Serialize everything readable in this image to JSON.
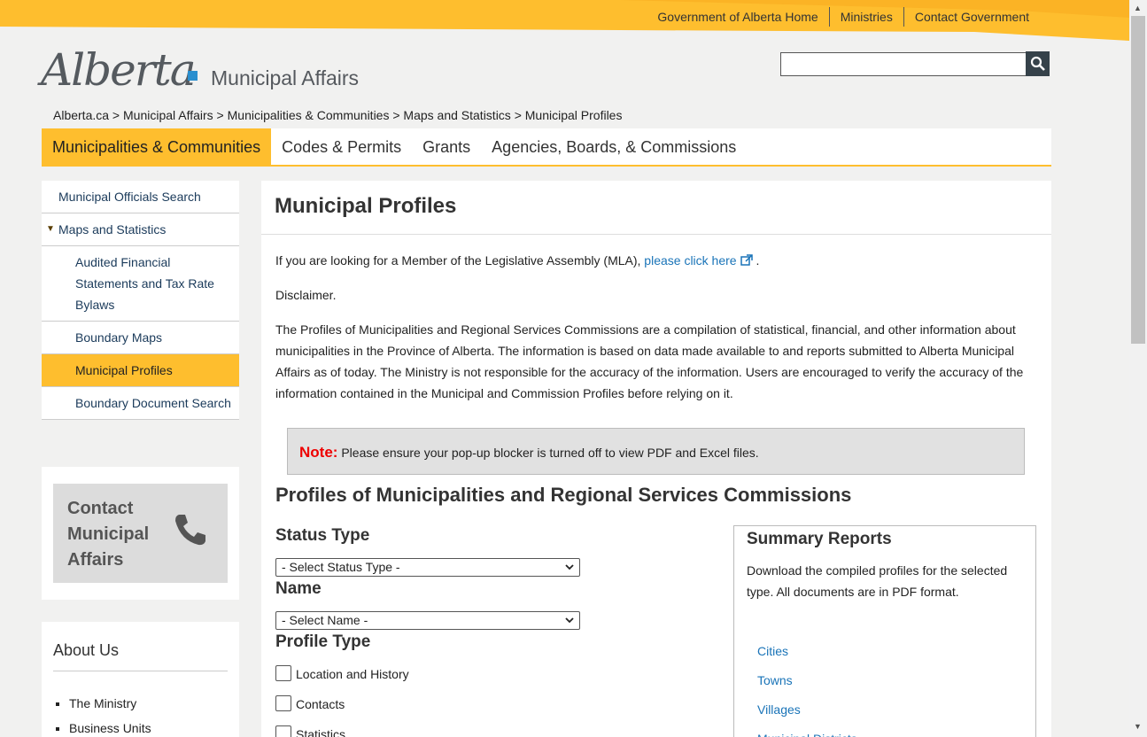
{
  "top_links": [
    "Government of Alberta Home",
    "Ministries",
    "Contact Government"
  ],
  "logo": {
    "script": "Alberta",
    "ministry": "Municipal Affairs"
  },
  "breadcrumb": "Alberta.ca > Municipal Affairs > Municipalities & Communities > Maps and Statistics > Municipal Profiles",
  "main_nav": [
    "Municipalities & Communities",
    "Codes & Permits",
    "Grants",
    "Agencies, Boards, & Commissions"
  ],
  "side_nav": {
    "officials": "Municipal Officials Search",
    "maps": "Maps and Statistics",
    "audited": "Audited Financial Statements and Tax Rate Bylaws",
    "boundary_maps": "Boundary Maps",
    "profiles": "Municipal Profiles",
    "boundary_doc": "Boundary Document Search"
  },
  "contact_box": "Contact Municipal Affairs",
  "about": {
    "title": "About Us",
    "items": [
      "The Ministry",
      "Business Units"
    ]
  },
  "content": {
    "title": "Municipal Profiles",
    "mla_text": "If you are looking for a Member of the Legislative Assembly (MLA), ",
    "mla_link": "please click here",
    "disclaimer": "Disclaimer.",
    "paragraph": "The Profiles of Municipalities and Regional Services Commissions are a compilation of statistical, financial, and other information about municipalities in the Province of Alberta. The information is based on data made available to and reports submitted to Alberta Municipal Affairs as of today. The Ministry is not responsible for the accuracy of the information. Users are encouraged to verify the accuracy of the information contained in the Municipal and Commission Profiles before relying on it.",
    "note_label": "Note:",
    "note_text": " Please ensure your pop-up blocker is turned off to view PDF and Excel files.",
    "section_title": "Profiles of Municipalities and Regional Services Commissions",
    "status_label": "Status Type",
    "status_value": "- Select Status Type -",
    "name_label": "Name",
    "name_value": "- Select Name -",
    "profile_label": "Profile Type",
    "checkboxes": [
      "Location and History",
      "Contacts",
      "Statistics"
    ]
  },
  "summary": {
    "title": "Summary Reports",
    "desc": "Download the compiled profiles for the selected type. All documents are in PDF format.",
    "links": [
      "Cities",
      "Towns",
      "Villages",
      "Municipal Districts"
    ]
  },
  "colors": {
    "accent": "#febe2e",
    "link": "#1a74b8",
    "note": "#e00000"
  }
}
